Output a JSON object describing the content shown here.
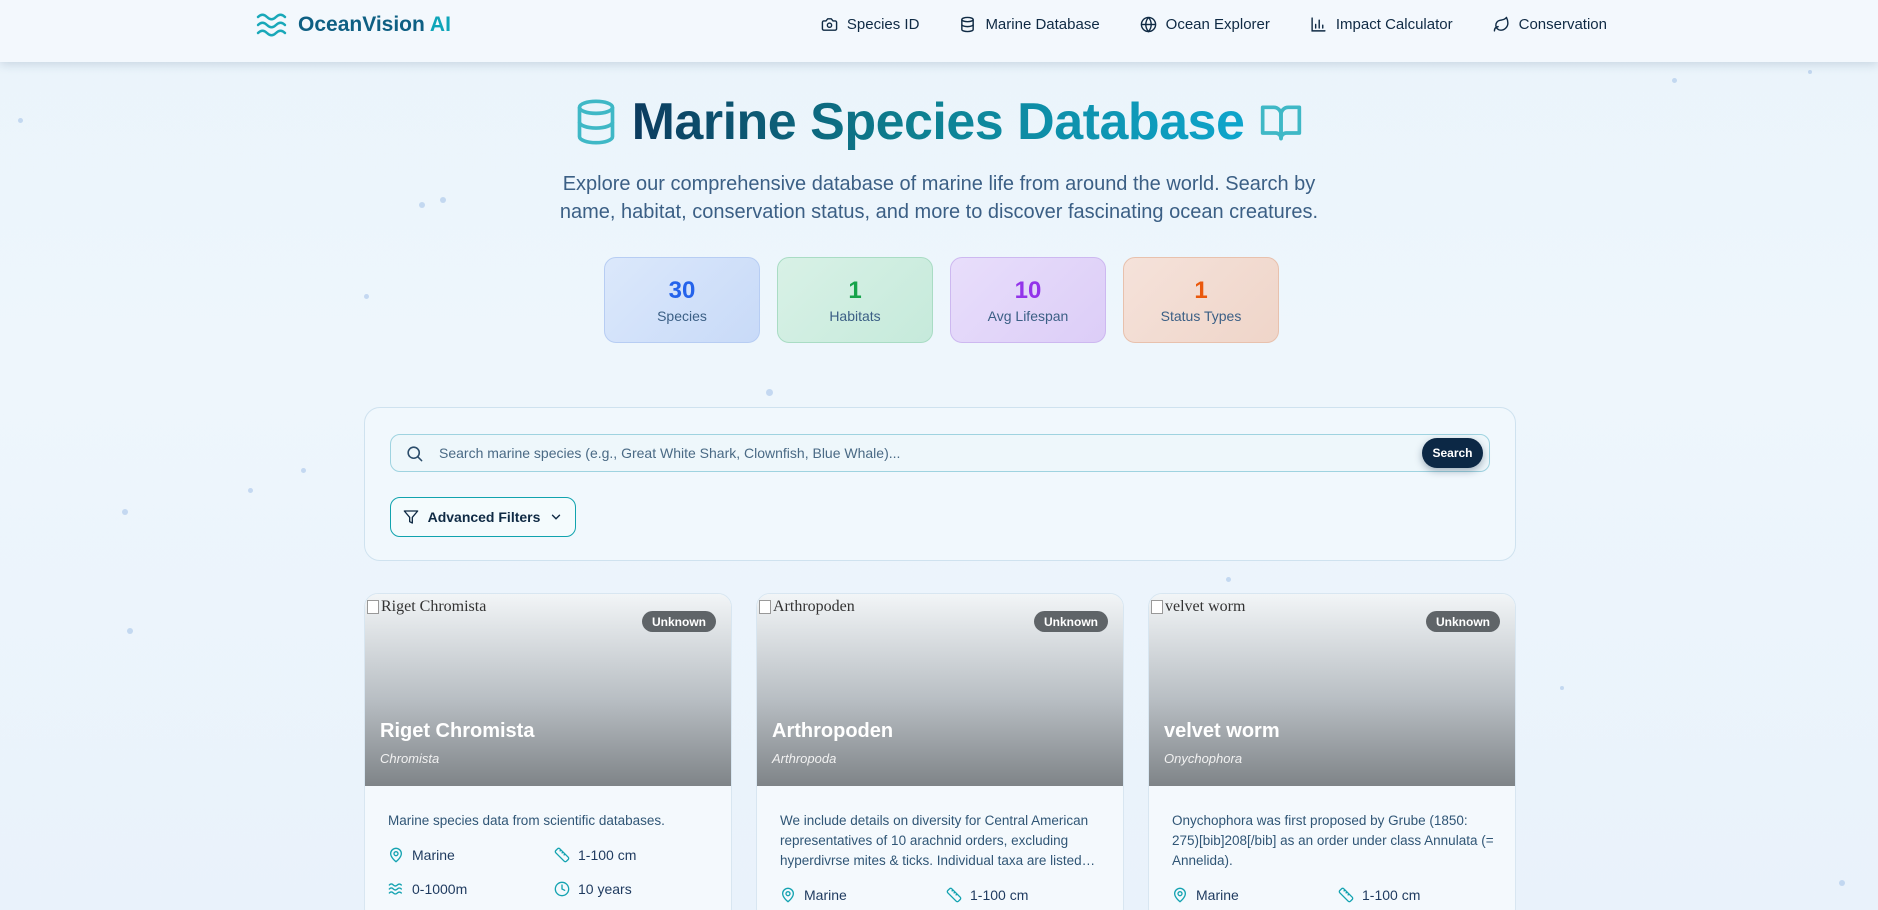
{
  "brand": {
    "name_part1": "Ocean",
    "name_part2": "Vision",
    "name_part3": " AI"
  },
  "nav": [
    {
      "label": "Species ID",
      "icon": "camera-icon"
    },
    {
      "label": "Marine Database",
      "icon": "database-icon"
    },
    {
      "label": "Ocean Explorer",
      "icon": "globe-icon"
    },
    {
      "label": "Impact Calculator",
      "icon": "bar-chart-icon"
    },
    {
      "label": "Conservation",
      "icon": "leaf-icon"
    }
  ],
  "hero": {
    "title": "Marine Species Database",
    "subtitle": "Explore our comprehensive database of marine life from around the world. Search by name, habitat, conservation status, and more to discover fascinating ocean creatures."
  },
  "stats": [
    {
      "value": "30",
      "label": "Species"
    },
    {
      "value": "1",
      "label": "Habitats"
    },
    {
      "value": "10",
      "label": "Avg Lifespan"
    },
    {
      "value": "1",
      "label": "Status Types"
    }
  ],
  "search": {
    "placeholder": "Search marine species (e.g., Great White Shark, Clownfish, Blue Whale)...",
    "button": "Search",
    "filters_label": "Advanced Filters"
  },
  "cards": [
    {
      "alt": "Riget Chromista",
      "status": "Unknown",
      "name": "Riget Chromista",
      "scientific": "Chromista",
      "description": "Marine species data from scientific databases.",
      "habitat": "Marine",
      "size": "1-100 cm",
      "depth": "0-1000m",
      "lifespan": "10 years"
    },
    {
      "alt": "Arthropoden",
      "status": "Unknown",
      "name": "Arthropoden",
      "scientific": "Arthropoda",
      "description": "We include details on diversity for Central American representatives of 10 arachnid orders, excluding hyperdivrse mites & ticks. Individual taxa are listed with their distribution.",
      "habitat": "Marine",
      "size": "1-100 cm"
    },
    {
      "alt": "velvet worm",
      "status": "Unknown",
      "name": "velvet worm",
      "scientific": "Onychophora",
      "description": "Onychophora was first proposed by Grube (1850: 275)[bib]208[/bib] as an order under class Annulata (= Annelida).",
      "habitat": "Marine",
      "size": "1-100 cm"
    }
  ]
}
